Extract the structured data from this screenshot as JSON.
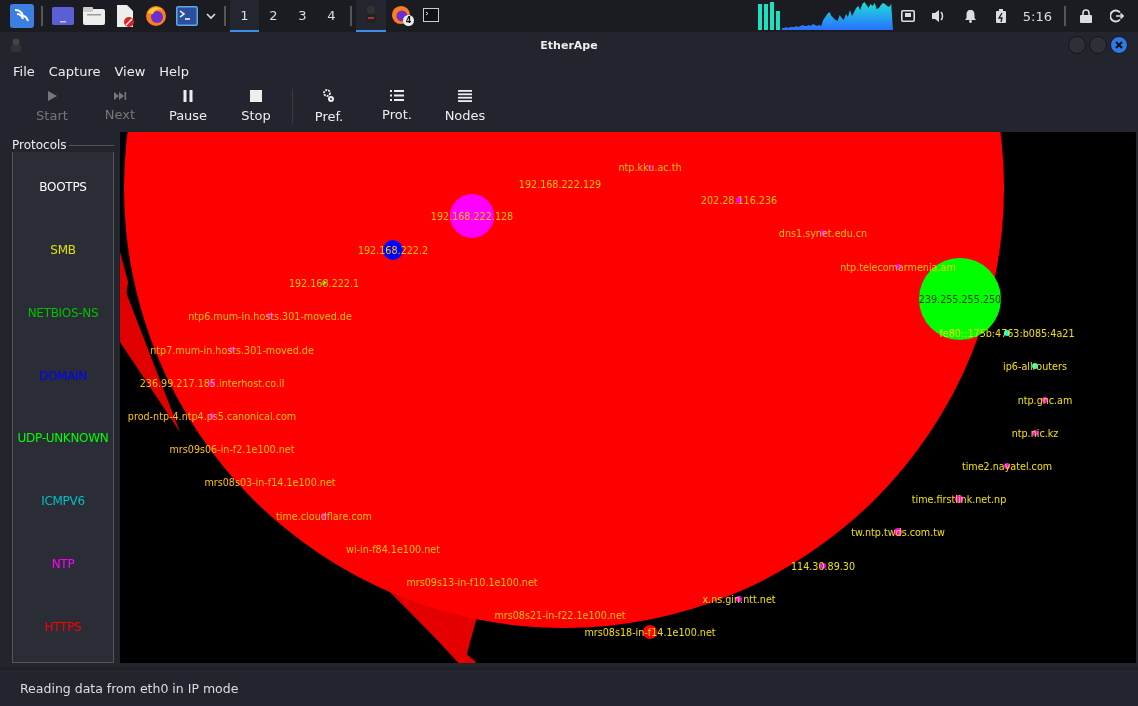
{
  "taskbar": {
    "workspaces": [
      {
        "label": "1",
        "selected": true
      },
      {
        "label": "2",
        "selected": false
      },
      {
        "label": "3",
        "selected": false
      },
      {
        "label": "4",
        "selected": false
      }
    ],
    "badge": "4",
    "clock": "5:16"
  },
  "window": {
    "title": "EtherApe"
  },
  "menu": [
    "File",
    "Capture",
    "View",
    "Help"
  ],
  "toolbar": [
    {
      "label": "Start",
      "disabled": true
    },
    {
      "label": "Next",
      "disabled": true
    },
    {
      "label": "Pause",
      "disabled": false
    },
    {
      "label": "Stop",
      "disabled": false
    },
    {
      "label": "Pref.",
      "disabled": false
    },
    {
      "label": "Prot.",
      "disabled": false
    },
    {
      "label": "Nodes",
      "disabled": false
    }
  ],
  "protocols": {
    "title": "Protocols",
    "items": [
      {
        "name": "BOOTPS",
        "color": "#ffffff"
      },
      {
        "name": "SMB",
        "color": "#e0e000"
      },
      {
        "name": "NETBIOS-NS",
        "color": "#00c000"
      },
      {
        "name": "DOMAIN",
        "color": "#0000ff"
      },
      {
        "name": "UDP-UNKNOWN",
        "color": "#00ff00"
      },
      {
        "name": "ICMPV6",
        "color": "#00c0c0"
      },
      {
        "name": "NTP",
        "color": "#ff00ff"
      },
      {
        "name": "HTTPS",
        "color": "#ff0000"
      }
    ]
  },
  "nodes": [
    {
      "label": "ntp.kku.ac.th",
      "color": "#ff00ff"
    },
    {
      "label": "192.168.222.129"
    },
    {
      "label": "202.28.116.236",
      "color": "#ff00ff"
    },
    {
      "label": "192.168.222.128",
      "color": "#ff00ff"
    },
    {
      "label": "dns1.synet.edu.cn",
      "color": "#ff00ff"
    },
    {
      "label": "192.168.222.2",
      "color": "#0000ff"
    },
    {
      "label": "ntp.telecomarmenia.am",
      "color": "#ff00ff"
    },
    {
      "label": "192.168.222.1",
      "color": "#00ff00"
    },
    {
      "label": "239.255.255.250",
      "color": "#00ff00"
    },
    {
      "label": "ntp6.mum-in.hosts.301-moved.de",
      "color": "#ff00ff"
    },
    {
      "label": "fe80::175b:4763:b085:4a21",
      "color": "#00ffff"
    },
    {
      "label": "ntp7.mum-in.hosts.301-moved.de",
      "color": "#ff00ff"
    },
    {
      "label": "ip6-allrouters",
      "color": "#00ffff"
    },
    {
      "label": "236.99.217.185.interhost.co.il",
      "color": "#ff00ff"
    },
    {
      "label": "ntp.gnc.am",
      "color": "#ff00ff"
    },
    {
      "label": "prod-ntp-4.ntp4.ps5.canonical.com",
      "color": "#ff00ff"
    },
    {
      "label": "ntp.nic.kz",
      "color": "#ff00ff"
    },
    {
      "label": "mrs09s06-in-f2.1e100.net"
    },
    {
      "label": "time2.nayatel.com",
      "color": "#ff00ff"
    },
    {
      "label": "mrs08s03-in-f14.1e100.net"
    },
    {
      "label": "time.firstlink.net.np",
      "color": "#ff00ff"
    },
    {
      "label": "time.cloudflare.com",
      "color": "#ff00ff"
    },
    {
      "label": "tw.ntp.twds.com.tw",
      "color": "#ff00ff"
    },
    {
      "label": "wi-in-f84.1e100.net"
    },
    {
      "label": "114.30.89.30",
      "color": "#ff00ff"
    },
    {
      "label": "mrs09s13-in-f10.1e100.net"
    },
    {
      "label": "x.ns.gin.ntt.net",
      "color": "#ff00ff"
    },
    {
      "label": "mrs08s21-in-f22.1e100.net"
    },
    {
      "label": "mrs08s18-in-f14.1e100.net",
      "color": "#ff0000"
    }
  ],
  "status_bar": "Reading data from eth0 in IP mode"
}
